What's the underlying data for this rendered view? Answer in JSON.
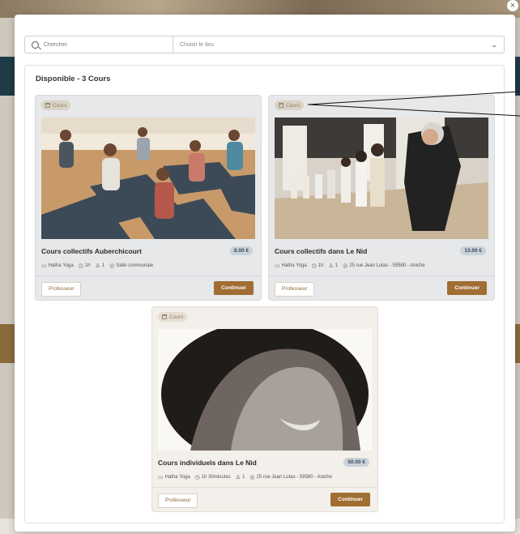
{
  "search": {
    "placeholder": "Chercher"
  },
  "place_select": {
    "selected": "Choisir le lieu"
  },
  "available_label": "Disponible - 3 Cours",
  "close_label": "×",
  "courses": [
    {
      "badge": "Cours",
      "title": "Cours collectifs Auberchicourt",
      "price": "8.00 €",
      "style": "Hatha Yoga",
      "duration": "1h",
      "people": "1",
      "location": "Salle communale",
      "teacher_label": "Professeur",
      "continue_label": "Continuer"
    },
    {
      "badge": "Cours",
      "title": "Cours collectifs dans Le Nid",
      "price": "13.00 €",
      "style": "Hatha Yoga",
      "duration": "1h",
      "people": "1",
      "location": "25 rue Jean Lutas - 59580 - Aniche",
      "teacher_label": "Professeur",
      "continue_label": "Continuer"
    },
    {
      "badge": "Cours",
      "title": "Cours individuels dans Le Nid",
      "price": "50.00 €",
      "style": "Hatha Yoga",
      "duration": "1h 30minutes",
      "people": "1",
      "location": "25 rue Jean Lutas - 59580 - Aniche",
      "teacher_label": "Professeur",
      "continue_label": "Continuer"
    }
  ],
  "icons": [
    "search-icon",
    "chevron-down-icon",
    "building-icon",
    "folder-icon",
    "clock-icon",
    "person-icon",
    "location-pin-icon"
  ]
}
